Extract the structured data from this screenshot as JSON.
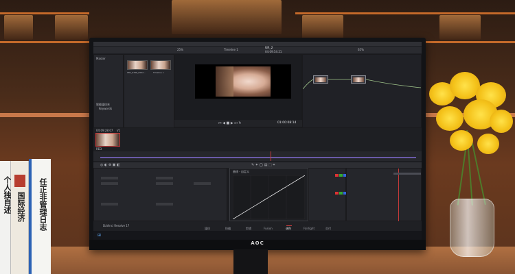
{
  "app": {
    "title": "DaVinci Resolve 17",
    "project_name": "UR_2",
    "timeline_name": "Timeline 1",
    "timecode_top": "04:09:54:21",
    "timecode_viewer": "01:00:08:14",
    "timecode_clip": "04:09:28:07",
    "clip_track": "V1",
    "clip_label": "RED",
    "zoom": "25%",
    "zoom_right": "65%",
    "media_pool": {
      "label": "Master",
      "clips": [
        {
          "name": "IMG_0346_0002..."
        },
        {
          "name": "Timeline 1"
        }
      ]
    },
    "left_labels": [
      "智能媒体夹",
      "Keywords"
    ],
    "curves_title": "曲线 - 自定义",
    "pages": [
      "媒体",
      "快编",
      "剪辑",
      "Fusion",
      "调色",
      "Fairlight",
      "交付"
    ],
    "active_page": "调色"
  },
  "monitor": {
    "brand": "AOC"
  },
  "books": [
    {
      "title": "个人独自述",
      "color": "#f2f2f0"
    },
    {
      "title": "国际经济",
      "color": "#eee9df"
    },
    {
      "title": "任正非管理日志",
      "color": "#f5f5f2"
    }
  ],
  "colors": {
    "accent_red": "#c63a3a",
    "flower_yellow": "#f4c21a",
    "wood": "#8a5533"
  }
}
